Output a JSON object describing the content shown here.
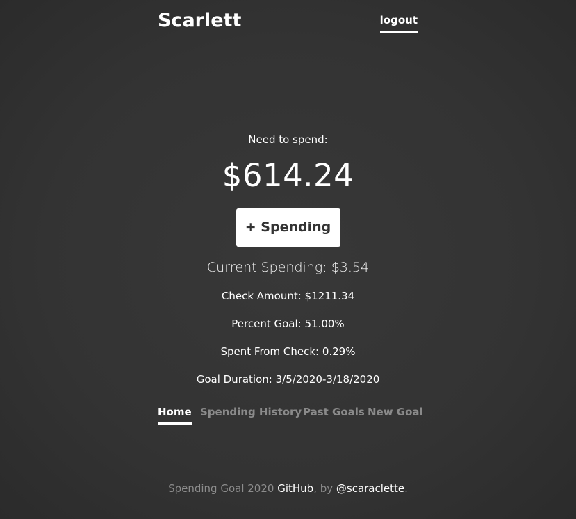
{
  "header": {
    "brand": "Scarlett",
    "logout_label": "logout"
  },
  "summary": {
    "need_label": "Need to spend:",
    "need_amount": "$614.24",
    "add_spending_label": "+ Spending",
    "current_spending": "Current Spending: $3.54",
    "check_amount": "Check Amount: $1211.34",
    "percent_goal": "Percent Goal: 51.00%",
    "spent_from_check": "Spent From Check: 0.29%",
    "goal_duration": "Goal Duration: 3/5/2020-3/18/2020"
  },
  "nav": {
    "items": [
      {
        "label": "Home",
        "active": true
      },
      {
        "label": "Spending History",
        "active": false
      },
      {
        "label": "Past Goals",
        "active": false
      },
      {
        "label": "New Goal",
        "active": false
      }
    ]
  },
  "footer": {
    "prefix": "Spending Goal 2020 ",
    "github_link": "GitHub",
    "middle": ", by ",
    "author_link": "@scaraclette",
    "suffix": "."
  },
  "colors": {
    "background": "#333333",
    "text": "#ffffff",
    "muted": "#8a8a8a"
  }
}
